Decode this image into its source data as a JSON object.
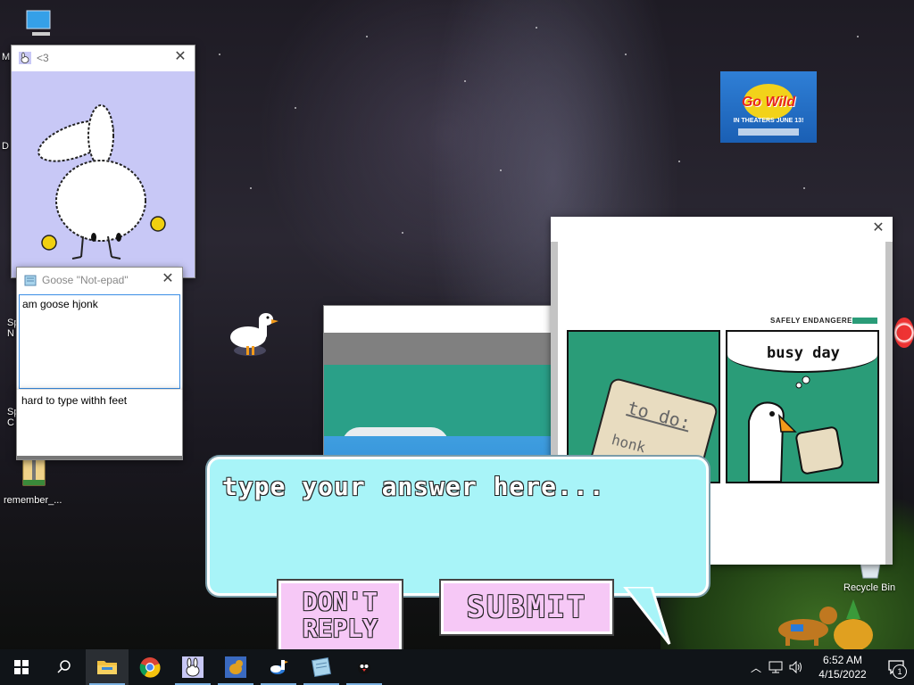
{
  "desktop": {
    "icons": [
      {
        "label": "M",
        "name": "my-computer"
      },
      {
        "label": "D",
        "name": "documents"
      },
      {
        "label": "Sp N",
        "name": "sp-n"
      },
      {
        "label": "Sp C",
        "name": "sp-c"
      },
      {
        "label": "remember_...",
        "name": "remember-file"
      },
      {
        "label": "Recycle Bin",
        "name": "recycle-bin"
      }
    ],
    "poster": {
      "title": "Go Wild",
      "subtitle": "IN THEATERS JUNE 13!"
    }
  },
  "bunny_window": {
    "title": "<3"
  },
  "notepad_window": {
    "title": "Goose \"Not-epad\"",
    "text": "am goose hjonk"
  },
  "notepad_window_2": {
    "text": "hard to type withh feet"
  },
  "comic_window": {
    "brand": "SAFELY ENDANGERED",
    "panel1_note": "to do:",
    "panel1_note2": "honk",
    "panel2_caption": "busy day"
  },
  "answer_dialog": {
    "placeholder": "type your answer here...",
    "dont_reply_label": "DON'T REPLY",
    "submit_label": "SUBMIT"
  },
  "taskbar": {
    "apps": [
      "start-icon",
      "search-icon",
      "file-explorer-icon",
      "chrome-icon",
      "bunny-app-icon",
      "dog-app-icon",
      "goose-app-icon",
      "notepad-app-icon",
      "penguin-app-icon"
    ],
    "time": "6:52 AM",
    "date": "4/15/2022",
    "notification_count": "1"
  },
  "colors": {
    "dialog_bg": "#a8f4f8",
    "button_bg": "#f6c8f6",
    "comic_green": "#2a9c78",
    "bunny_bg": "#c8c8f6"
  }
}
